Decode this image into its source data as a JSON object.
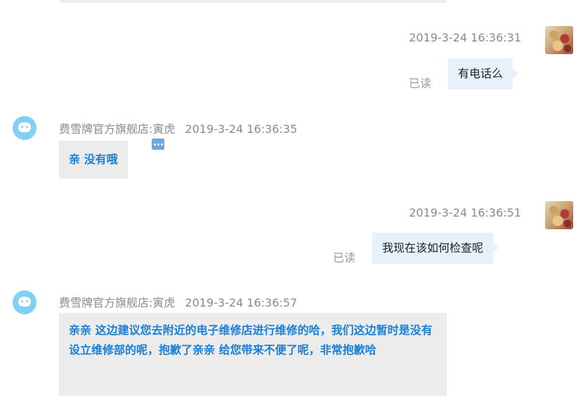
{
  "messages": [
    {
      "direction": "outgoing",
      "timestamp": "2019-3-24 16:36:31",
      "text": "有电话么",
      "status": "已读"
    },
    {
      "direction": "incoming",
      "sender": "费雪牌官方旗舰店:寅虎",
      "timestamp": "2019-3-24 16:36:35",
      "text": "亲 没有哦"
    },
    {
      "direction": "outgoing",
      "timestamp": "2019-3-24 16:36:51",
      "text": "我现在该如何检查呢",
      "status": "已读"
    },
    {
      "direction": "incoming",
      "sender": "费雪牌官方旗舰店:寅虎",
      "timestamp": "2019-3-24 16:36:57",
      "text": "亲亲 这边建议您去附近的电子维修店进行维修的哈，我们这边暂时是没有设立维修部的呢，抱歉了亲亲   给您带来不便了呢，非常抱歉哈"
    }
  ],
  "icons": {
    "agent_avatar": "cartoon-bird-avatar",
    "user_avatar": "photo-avatar",
    "more": "more-options-icon"
  },
  "colors": {
    "incoming_text": "#1a7fd6",
    "outgoing_bubble": "#e6f1fc",
    "incoming_bubble": "#ececec",
    "agent_avatar_bg": "#7fd0f2"
  }
}
